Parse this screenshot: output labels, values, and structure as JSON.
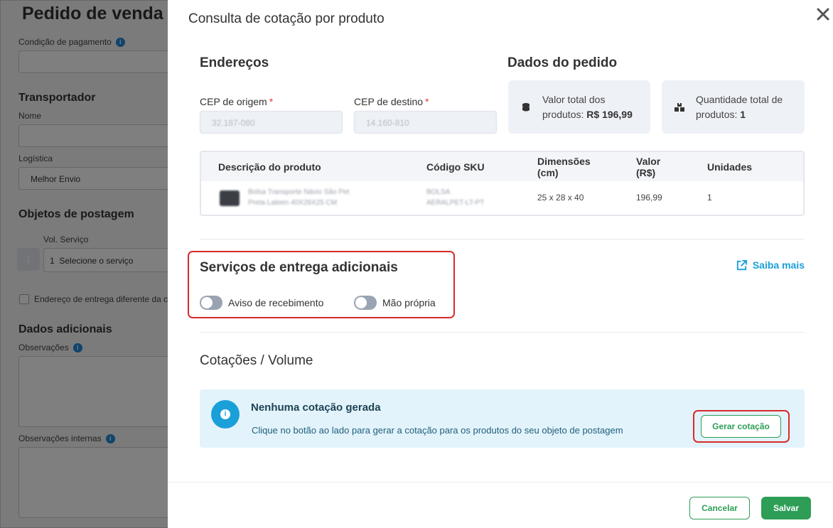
{
  "background": {
    "title": "Pedido de venda",
    "payment_condition_label": "Condição de pagamento",
    "carrier_section": "Transportador",
    "name_label": "Nome",
    "logistics_label": "Logística",
    "logistics_value": "Melhor Envio",
    "postage_section": "Objetos de postagem",
    "vol_service_label": "Vol. Serviço",
    "vol_badge": "1",
    "service_number": "1",
    "service_placeholder": "Selecione o serviço",
    "different_address_label": "Endereço de entrega diferente da c",
    "additional_section": "Dados adicionais",
    "notes_label": "Observações",
    "internal_notes_label": "Observações internas"
  },
  "modal": {
    "title": "Consulta de cotação por produto",
    "addresses": {
      "heading": "Endereços",
      "origin_label": "CEP de origem",
      "origin_value": "32.187-080",
      "destination_label": "CEP de destino",
      "destination_value": "14.160-810",
      "required_mark": "*"
    },
    "order_data": {
      "heading": "Dados do pedido",
      "total_value_label": "Valor total dos",
      "total_value_label2": "produtos:",
      "total_value": "R$ 196,99",
      "total_qty_label": "Quantidade total de",
      "total_qty_label2": "produtos:",
      "total_qty": "1"
    },
    "table": {
      "headers": {
        "description": "Descrição do produto",
        "sku": "Código SKU",
        "dimensions_1": "Dimensões",
        "dimensions_2": "(cm)",
        "value_1": "Valor",
        "value_2": "(R$)",
        "units": "Unidades"
      },
      "rows": [
        {
          "description_1": "Bolsa Transporte Návio São Pet",
          "description_2": "Preta Lateen 40X28X25 CM",
          "sku_1": "BOLSA",
          "sku_2": "AERALPET-LT-PT",
          "dimensions": "25 x 28 x 40",
          "value": "196,99",
          "units": "1"
        }
      ]
    },
    "extra_services": {
      "heading": "Serviços de entrega adicionais",
      "toggle_1": "Aviso de recebimento",
      "toggle_2": "Mão própria",
      "learn_more": "Saiba mais"
    },
    "quotes": {
      "heading": "Cotações / Volume",
      "alert_title": "Nenhuma cotação gerada",
      "alert_text": "Clique no botão ao lado para gerar a cotação para os produtos do seu objeto de postagem",
      "generate_button": "Gerar cotação"
    },
    "footer": {
      "cancel_button": "Cancelar",
      "save_button": "Salvar"
    }
  },
  "colors": {
    "accent_green": "#2e9e57",
    "info_blue": "#1aa0d8",
    "highlight_red": "#d92a2a"
  }
}
